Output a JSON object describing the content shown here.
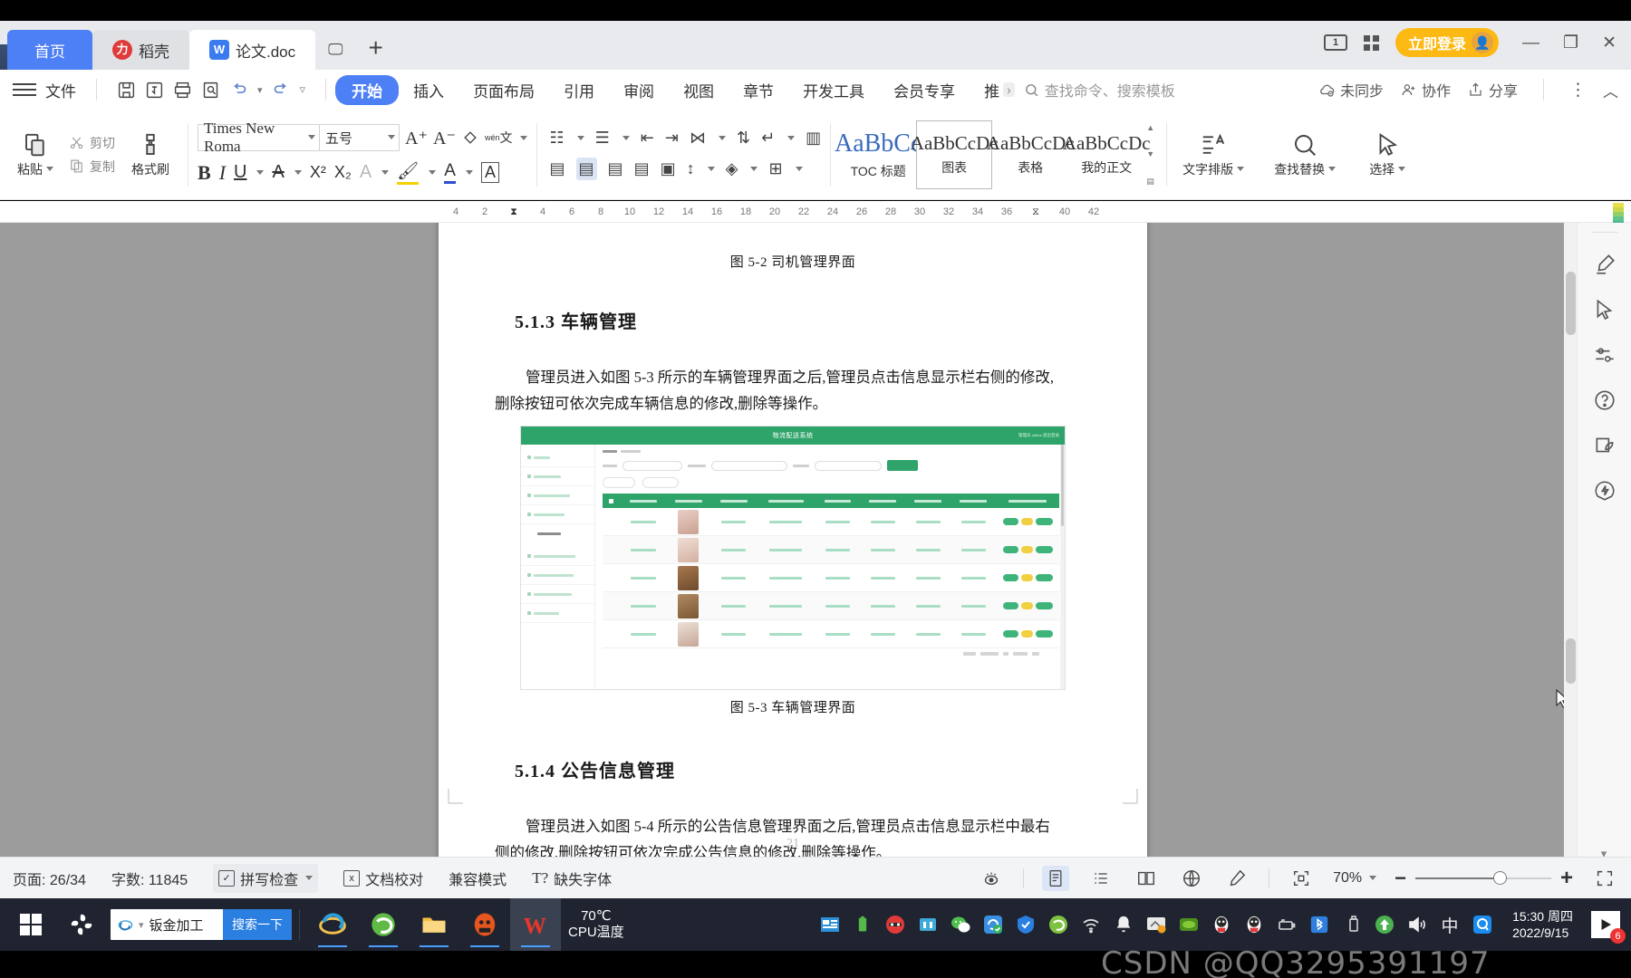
{
  "window": {
    "tabs": [
      {
        "label": "首页",
        "type": "home"
      },
      {
        "label": "稻壳",
        "type": "inactive",
        "icon": "docer-icon"
      },
      {
        "label": "论文.doc",
        "type": "active",
        "icon": "wps-writer-icon"
      }
    ],
    "new_tab_label": "+",
    "login_button": "立即登录",
    "minimize": "—",
    "maximize": "❐",
    "close": "✕",
    "monitor_label": "1"
  },
  "ribbon": {
    "file_menu": "文件",
    "tabs": [
      {
        "label": "开始",
        "active": true
      },
      {
        "label": "插入",
        "active": false
      },
      {
        "label": "页面布局",
        "active": false
      },
      {
        "label": "引用",
        "active": false
      },
      {
        "label": "审阅",
        "active": false
      },
      {
        "label": "视图",
        "active": false
      },
      {
        "label": "章节",
        "active": false
      },
      {
        "label": "开发工具",
        "active": false
      },
      {
        "label": "会员专享",
        "active": false
      },
      {
        "label": "推",
        "active": false
      }
    ],
    "more_arrow": "›",
    "search_placeholder": "查找命令、搜索模板",
    "right_items": [
      {
        "label": "未同步",
        "icon": "cloud-sync-icon"
      },
      {
        "label": "协作",
        "icon": "collaborate-icon"
      },
      {
        "label": "分享",
        "icon": "share-icon"
      }
    ],
    "overflow_icon": "⋮",
    "collapse_icon": "︿"
  },
  "home_tab": {
    "paste_label": "粘贴",
    "cut_label": "剪切",
    "copy_label": "复制",
    "format_painter_label": "格式刷",
    "font_name": "Times New Roma",
    "font_size": "五号",
    "grow_font": "A⁺",
    "shrink_font": "A⁻",
    "clear_format": "清除格式",
    "pinyin": "wén 文",
    "bold": "B",
    "italic": "I",
    "underline": "U",
    "strikethrough": "A",
    "superscript": "X²",
    "subscript": "X₂",
    "text_effects": "A",
    "highlight": "A",
    "font_color": "A",
    "char_border": "A",
    "styles": [
      {
        "preview": "AaBbCc",
        "name": "TOC 标题",
        "selected": false,
        "big": true
      },
      {
        "preview": "AaBbCcDc",
        "name": "图表",
        "selected": true,
        "big": false
      },
      {
        "preview": "AaBbCcDc",
        "name": "表格",
        "selected": false,
        "big": false
      },
      {
        "preview": "AaBbCcDc",
        "name": "我的正文",
        "selected": false,
        "big": false
      }
    ],
    "right_groups": [
      {
        "label": "文字排版",
        "icon": "text-layout-icon"
      },
      {
        "label": "查找替换",
        "icon": "find-replace-icon"
      },
      {
        "label": "选择",
        "icon": "select-icon"
      }
    ]
  },
  "ruler": {
    "ticks": [
      "4",
      "2",
      "2",
      "4",
      "6",
      "8",
      "10",
      "12",
      "14",
      "16",
      "18",
      "20",
      "22",
      "24",
      "26",
      "28",
      "30",
      "32",
      "34",
      "36",
      "40",
      "42"
    ]
  },
  "document": {
    "figure_caption_top": "图 5-2 司机管理界面",
    "heading_1": "5.1.3  车辆管理",
    "paragraph_1_line_1": "管理员进入如图 5-3 所示的车辆管理界面之后,管理员点击信息显示栏右侧的修改,",
    "paragraph_1_line_2": "删除按钮可依次完成车辆信息的修改,删除等操作。",
    "figure_caption_bottom": "图 5-3 车辆管理界面",
    "heading_2": "5.1.4  公告信息管理",
    "paragraph_2_line_1": "管理员进入如图 5-4 所示的公告信息管理界面之后,管理员点击信息显示栏中最右",
    "paragraph_2_line_2": "侧的修改,删除按钮可依次完成公告信息的修改,删除等操作。",
    "page_number": "21",
    "embedded_screenshot": {
      "title": "物流配送系统",
      "header_right": "管理员 admin  退出登录",
      "sidebar_items": [
        "首页",
        "个人中心",
        "司机信息管理",
        "车辆管理",
        "车辆管理",
        "公告信息管理",
        "配送订单管理",
        "运输信息管理",
        "系统管理"
      ],
      "selected_sidebar": "车辆管理",
      "table_rows": 5,
      "pagination": "共 5 条"
    }
  },
  "status_bar": {
    "page_label": "页面: 26/34",
    "word_count": "字数: 11845",
    "spell_check": "拼写检查",
    "doc_proof": "文档校对",
    "compat_mode": "兼容模式",
    "missing_font": "缺失字体",
    "zoom": "70%",
    "zoom_out": "−",
    "zoom_in": "+",
    "view_modes": [
      {
        "name": "page-view",
        "glyph": "▤",
        "selected": true
      },
      {
        "name": "outline-view",
        "glyph": "☰",
        "selected": false
      },
      {
        "name": "reading-view",
        "glyph": "▯▯",
        "selected": false
      },
      {
        "name": "web-view",
        "glyph": "⊕",
        "selected": false
      },
      {
        "name": "writing-view",
        "glyph": "✎",
        "selected": false
      }
    ],
    "eye_protect": "护眼模式",
    "fullscreen": "全屏"
  },
  "taskbar": {
    "search_text": "钣金加工",
    "search_button": "搜索一下",
    "cpu_temp_value": "70℃",
    "cpu_temp_label": "CPU温度",
    "clock_time": "15:30 周四",
    "clock_date": "2022/9/15",
    "notification_badge": "6",
    "ime_indicator": "中"
  },
  "watermark": "CSDN @QQ3295391197",
  "colors": {
    "accent_blue": "#4d7ff5",
    "login_orange": "#fdb913",
    "shot_green": "#2fa46a",
    "taskbar": "#1f2430"
  }
}
